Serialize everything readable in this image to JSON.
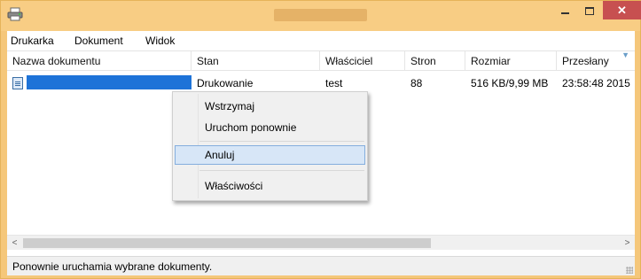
{
  "window": {
    "title": "",
    "minimize_symbol": "",
    "close_symbol": "✕"
  },
  "menubar": {
    "items": [
      "Drukarka",
      "Dokument",
      "Widok"
    ]
  },
  "table": {
    "columns": [
      "Nazwa dokumentu",
      "Stan",
      "Właściciel",
      "Stron",
      "Rozmiar",
      "Przesłany"
    ],
    "rows": [
      {
        "name": "",
        "status": "Drukowanie",
        "owner": "test",
        "pages": "88",
        "size": "516 KB/9,99 MB",
        "submitted": "23:58:48 2015"
      }
    ]
  },
  "context_menu": {
    "items": [
      "Wstrzymaj",
      "Uruchom ponownie",
      "Anuluj",
      "Właściwości"
    ],
    "selected": "Anuluj"
  },
  "scrollbar": {
    "left_arrow": "<",
    "right_arrow": ">"
  },
  "statusbar": {
    "text": "Ponownie uruchamia wybrane dokumenty."
  },
  "colors": {
    "titlebar": "#f8cd84",
    "close_button": "#c75050",
    "selection": "#1e73d8",
    "menu_highlight": "#d7e6f7"
  }
}
